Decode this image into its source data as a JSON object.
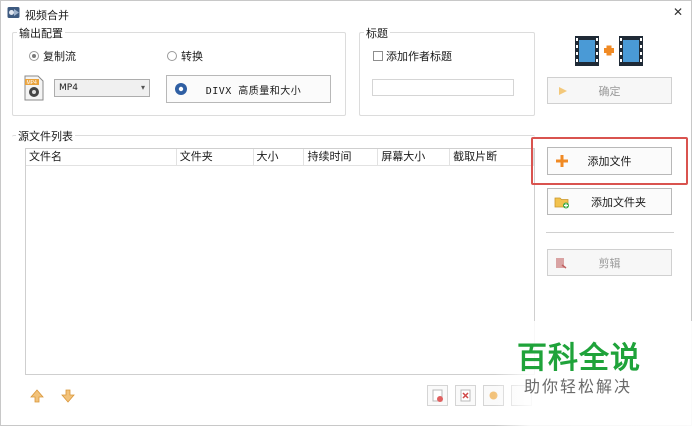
{
  "window": {
    "title": "视频合并",
    "close_glyph": "✕"
  },
  "output": {
    "group_label": "输出配置",
    "radio_copy": "复制流",
    "radio_convert": "转换",
    "selected_mode": "复制流",
    "format_icon_text": "MP4",
    "format_value": "MP4",
    "quality_button": "DIVX 高质量和大小"
  },
  "title_box": {
    "group_label": "标题",
    "checkbox_label": "添加作者标题",
    "checkbox_checked": false,
    "text_value": ""
  },
  "actions": {
    "confirm": "确定",
    "add_file": "添加文件",
    "add_folder": "添加文件夹",
    "clip": "剪辑"
  },
  "file_list": {
    "section_label": "源文件列表",
    "columns": [
      "文件名",
      "文件夹",
      "大小",
      "持续时间",
      "屏幕大小",
      "截取片断"
    ],
    "rows": []
  },
  "watermark": {
    "title": "百科全说",
    "subtitle": "助你轻松解决"
  },
  "colors": {
    "highlight": "#d9534f",
    "watermark_green": "#1fa33a",
    "add_plus": "#f08a24"
  }
}
